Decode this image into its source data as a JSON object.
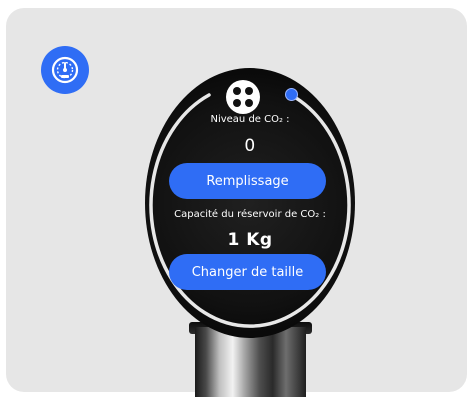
{
  "gauge": {
    "co2_level_label": "Niveau de CO₂ :",
    "co2_level_value": "0",
    "fill_button": "Remplissage",
    "tank_capacity_label": "Capacité du réservoir de CO₂ :",
    "tank_capacity_value": "1 Kg",
    "change_size_button": "Changer de taille"
  },
  "colors": {
    "accent": "#2f6df5",
    "card_background": "#e6e6e6",
    "dial_background": "#111111"
  },
  "icons": [
    "gauge-icon",
    "knob-icon",
    "indicator-dot"
  ]
}
